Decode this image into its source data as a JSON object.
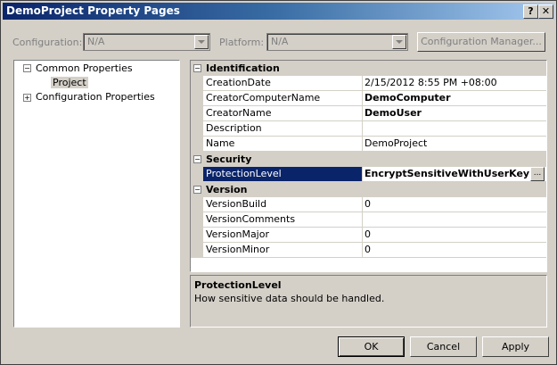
{
  "window": {
    "title": "DemoProject Property Pages",
    "help_label": "?",
    "close_label": "✕"
  },
  "toolbar": {
    "configuration_label": "Configuration:",
    "configuration_value": "N/A",
    "platform_label": "Platform:",
    "platform_value": "N/A",
    "config_manager_label": "Configuration Manager..."
  },
  "tree": {
    "items": [
      {
        "label": "Common Properties",
        "toggle": "−"
      },
      {
        "label": "Project"
      },
      {
        "label": "Configuration Properties",
        "toggle": "+"
      }
    ]
  },
  "grid": {
    "categories": [
      {
        "name": "Identification",
        "toggle": "−",
        "properties": [
          {
            "name": "CreationDate",
            "value": "2/15/2012 8:55 PM +08:00"
          },
          {
            "name": "CreatorComputerName",
            "value": "DemoComputer"
          },
          {
            "name": "CreatorName",
            "value": "DemoUser"
          },
          {
            "name": "Description",
            "value": ""
          },
          {
            "name": "Name",
            "value": "DemoProject"
          }
        ]
      },
      {
        "name": "Security",
        "toggle": "−",
        "properties": [
          {
            "name": "ProtectionLevel",
            "value": "EncryptSensitiveWithUserKey",
            "button": "..."
          }
        ]
      },
      {
        "name": "Version",
        "toggle": "−",
        "properties": [
          {
            "name": "VersionBuild",
            "value": "0"
          },
          {
            "name": "VersionComments",
            "value": ""
          },
          {
            "name": "VersionMajor",
            "value": "0"
          },
          {
            "name": "VersionMinor",
            "value": "0"
          }
        ]
      }
    ]
  },
  "description": {
    "title": "ProtectionLevel",
    "text": "How sensitive data should be handled."
  },
  "buttons": {
    "ok": "OK",
    "cancel": "Cancel",
    "apply": "Apply"
  },
  "colors": {
    "title_active": "#0a246a",
    "face": "#d4d0c8",
    "selection": "#0a246a"
  }
}
